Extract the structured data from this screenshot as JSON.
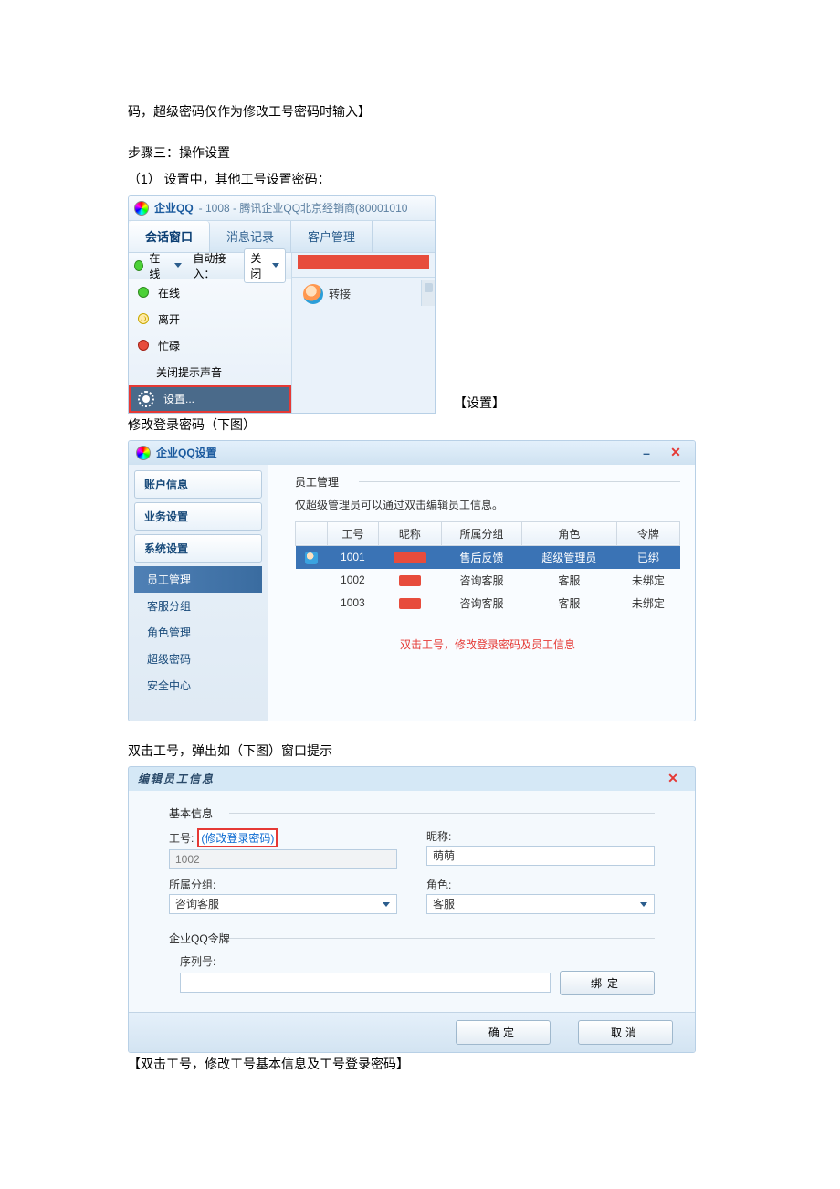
{
  "doc": {
    "line1": "码，超级密码仅作为修改工号密码时输入】",
    "step3": "步骤三：操作设置",
    "step3_1": "（1）  设置中，其他工号设置密码：",
    "caption1": "【设置】",
    "line_after1": "修改登录密码（下图）",
    "line_after2": "双击工号，弹出如（下图）窗口提示",
    "last": "【双击工号，修改工号基本信息及工号登录密码】"
  },
  "ss1": {
    "app": "企业QQ",
    "title_suffix": " - 1008 - 腾讯企业QQ北京经销商(80001010",
    "tabs": [
      "会话窗口",
      "消息记录",
      "客户管理"
    ],
    "status_online": "在线",
    "auto_label": "自动接入：",
    "auto_value": "关闭",
    "menu": {
      "online": "在线",
      "away": "离开",
      "busy": "忙碌",
      "mute": "关闭提示声音",
      "settings": "设置..."
    },
    "transfer": "转接"
  },
  "ss2": {
    "title": "企业QQ设置",
    "side": {
      "account": "账户信息",
      "biz": "业务设置",
      "sys": "系统设置"
    },
    "subs": {
      "emp": "员工管理",
      "group": "客服分组",
      "role": "角色管理",
      "pwd": "超级密码",
      "sec": "安全中心"
    },
    "section": "员工管理",
    "hint": "仅超级管理员可以通过双击编辑员工信息。",
    "cols": {
      "id": "工号",
      "nick": "昵称",
      "group": "所属分组",
      "role": "角色",
      "token": "令牌"
    },
    "rows": [
      {
        "id": "1001",
        "group": "售后反馈",
        "role": "超级管理员",
        "token": "已绑"
      },
      {
        "id": "1002",
        "group": "咨询客服",
        "role": "客服",
        "token": "未绑定"
      },
      {
        "id": "1003",
        "group": "咨询客服",
        "role": "客服",
        "token": "未绑定"
      }
    ],
    "rednote": "双击工号，修改登录密码及员工信息"
  },
  "ss3": {
    "title": "编辑员工信息",
    "sect_basic": "基本信息",
    "lab_id": "工号:",
    "link_pwd": "(修改登录密码)",
    "val_id": "1002",
    "lab_nick": "昵称:",
    "val_nick": "萌萌",
    "lab_group": "所属分组:",
    "val_group": "咨询客服",
    "lab_role": "角色:",
    "val_role": "客服",
    "sect_token": "企业QQ令牌",
    "lab_serial": "序列号:",
    "btn_bind": "绑定",
    "btn_ok": "确定",
    "btn_cancel": "取消"
  }
}
